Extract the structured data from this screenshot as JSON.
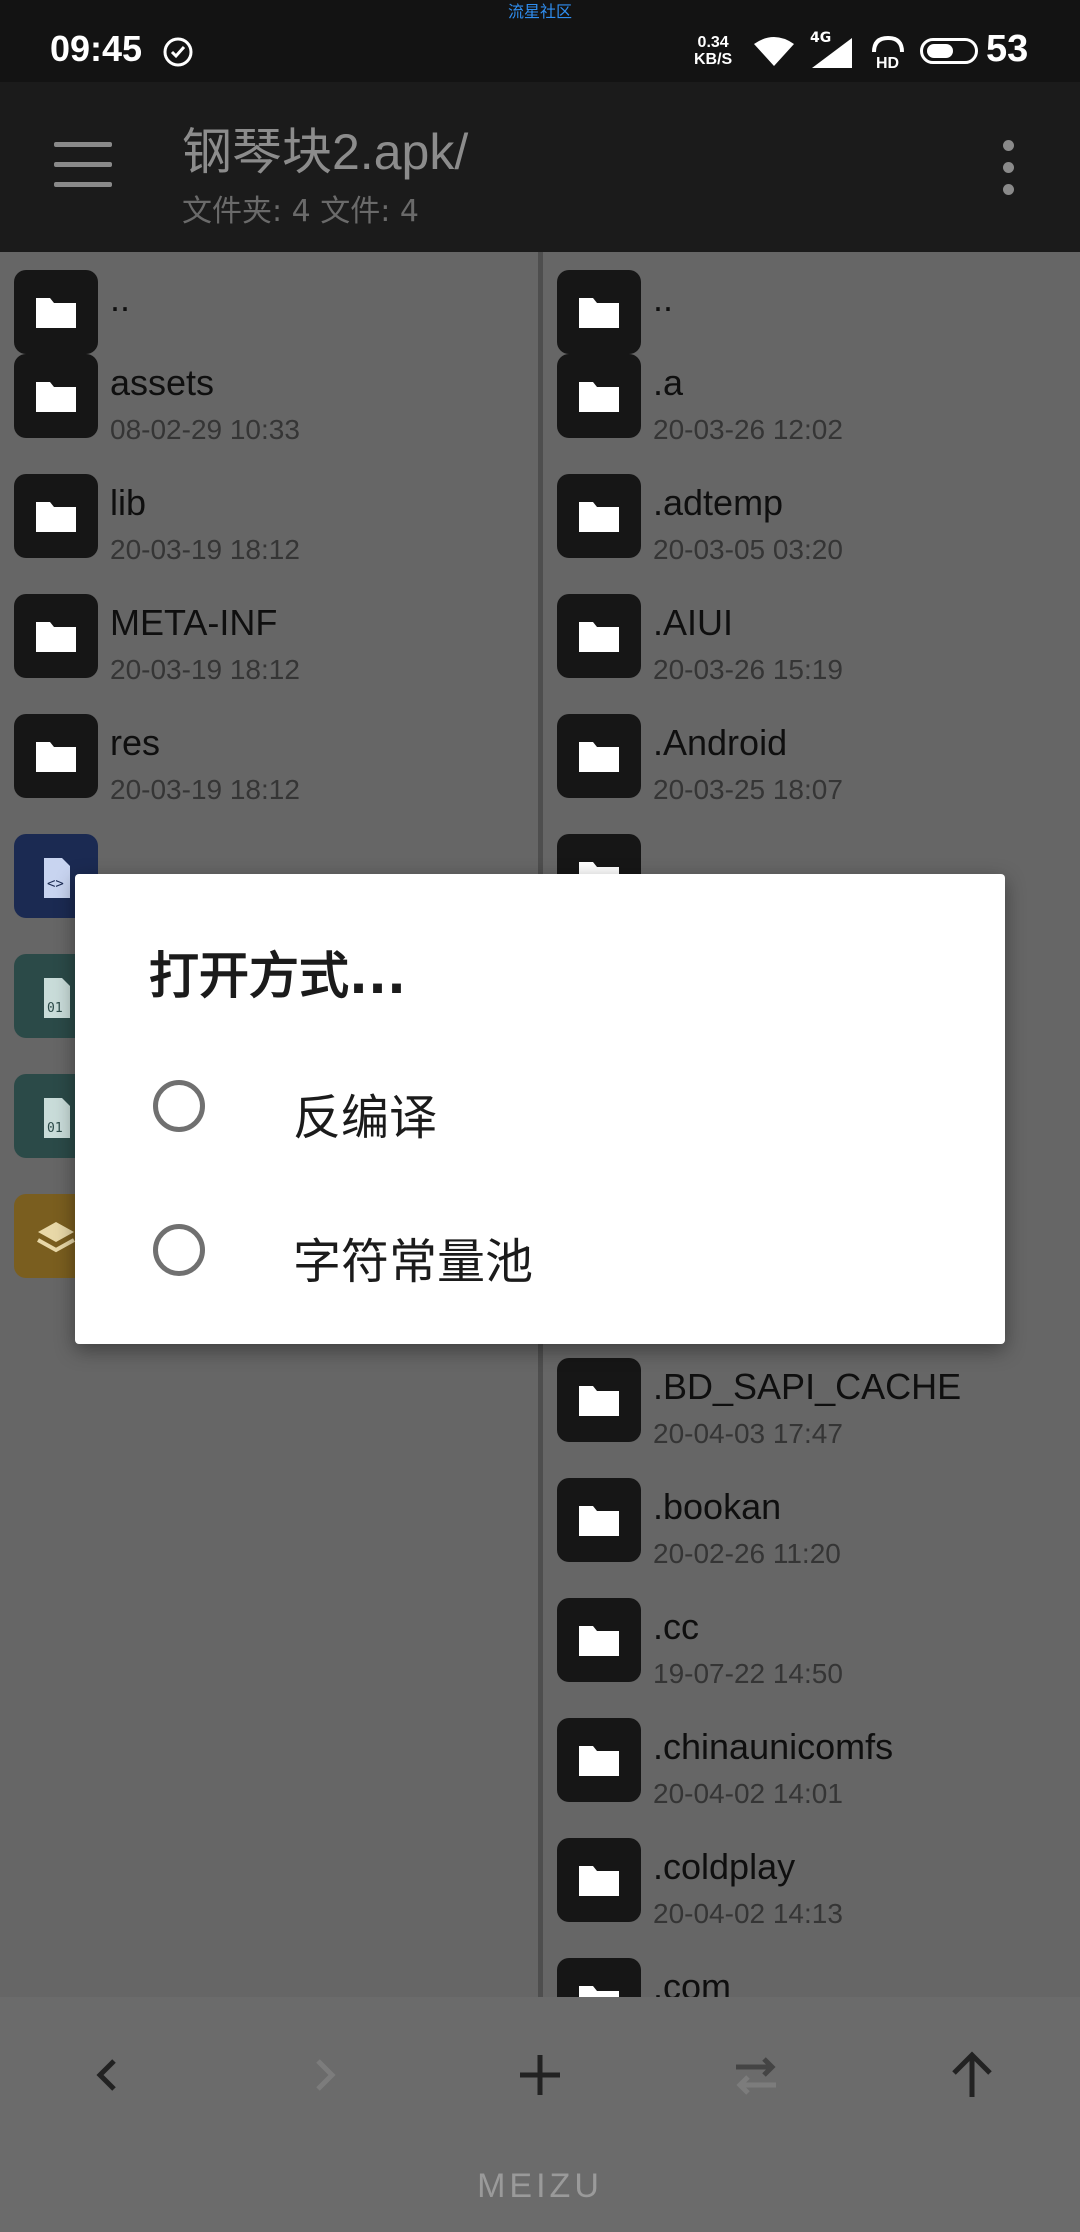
{
  "status_bar": {
    "time": "09:45",
    "watermark": "流星社区",
    "net_speed_value": "0.34",
    "net_speed_unit": "KB/S",
    "network": "4G",
    "hd": "HD",
    "battery": "53"
  },
  "app_bar": {
    "title": "钢琴块2.apk/",
    "subtitle": "文件夹: 4  文件: 4"
  },
  "left_pane": {
    "items": [
      {
        "name": "..",
        "date": ""
      },
      {
        "name": "assets",
        "date": "08-02-29 10:33"
      },
      {
        "name": "lib",
        "date": "20-03-19 18:12"
      },
      {
        "name": "META-INF",
        "date": "20-03-19 18:12"
      },
      {
        "name": "res",
        "date": "20-03-19 18:12"
      }
    ]
  },
  "right_pane": {
    "items": [
      {
        "name": "..",
        "date": ""
      },
      {
        "name": ".a",
        "date": "20-03-26 12:02"
      },
      {
        "name": ".adtemp",
        "date": "20-03-05 03:20"
      },
      {
        "name": ".AIUI",
        "date": "20-03-26 15:19"
      },
      {
        "name": ".Android",
        "date": "20-03-25 18:07"
      }
    ],
    "items_lower": [
      {
        "name": ".BD_SAPI_CACHE",
        "date": "20-04-03 17:47"
      },
      {
        "name": ".bookan",
        "date": "20-02-26 11:20"
      },
      {
        "name": ".cc",
        "date": "19-07-22 14:50"
      },
      {
        "name": ".chinaunicomfs",
        "date": "20-04-02 14:01"
      },
      {
        "name": ".coldplay",
        "date": "20-04-02 14:13"
      },
      {
        "name": ".com",
        "date": ""
      }
    ]
  },
  "dialog": {
    "title": "打开方式...",
    "options": [
      {
        "label": "反编译"
      },
      {
        "label": "字符常量池"
      }
    ]
  },
  "bottom_bar": {
    "brand": "MEIZU"
  },
  "colors": {
    "dim_background": "#666666",
    "folder_icon": "#161616",
    "dialog": "#ffffff"
  }
}
